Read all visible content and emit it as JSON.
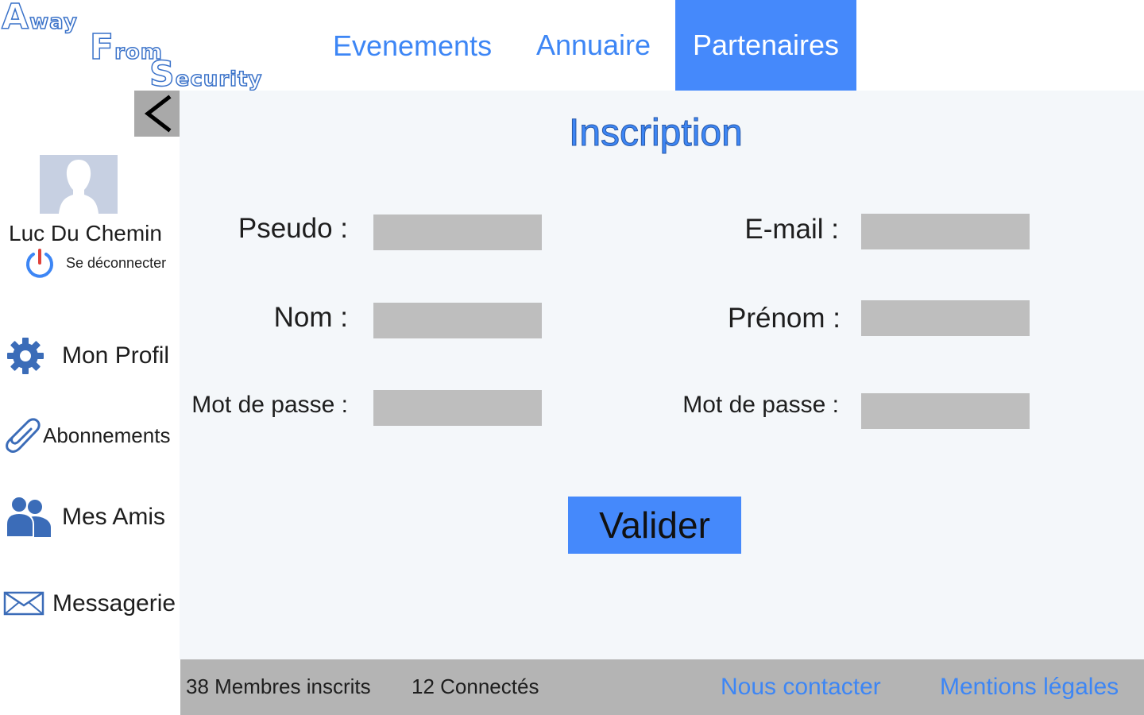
{
  "logo": {
    "line1": {
      "initial": "A",
      "rest": "way"
    },
    "line2": {
      "initial": "F",
      "rest": "rom"
    },
    "line3": {
      "initial": "S",
      "rest": "ecurity"
    }
  },
  "nav": {
    "items": [
      {
        "label": "Evenements"
      },
      {
        "label": "Annuaire"
      },
      {
        "label": "Partenaires",
        "active": true
      }
    ]
  },
  "sidebar": {
    "back_icon": "chevron-left-icon",
    "user_name": "Luc Du Chemin",
    "logout_label": "Se déconnecter",
    "items": [
      {
        "label": "Mon Profil",
        "icon": "gear-icon"
      },
      {
        "label": "Abonnements",
        "icon": "paperclip-icon"
      },
      {
        "label": "Mes Amis",
        "icon": "friends-icon"
      },
      {
        "label": "Messagerie",
        "icon": "envelope-icon"
      }
    ]
  },
  "form": {
    "title": "Inscription",
    "pseudo_label": "Pseudo :",
    "email_label": "E-mail :",
    "nom_label": "Nom :",
    "prenom_label": "Prénom :",
    "password_label": "Mot de passe :",
    "password_confirm_label": "Mot de passe :",
    "submit_label": "Valider"
  },
  "footer": {
    "members": "38 Membres inscrits",
    "connected": "12 Connectés",
    "contact": "Nous contacter",
    "legal": "Mentions légales"
  },
  "colors": {
    "accent": "#4589fb",
    "link": "#3d86f5",
    "icon": "#3b6cb8",
    "content_bg": "#f4f7fa",
    "field_bg": "#bebebe",
    "footer_bg": "#b4b4b4"
  }
}
